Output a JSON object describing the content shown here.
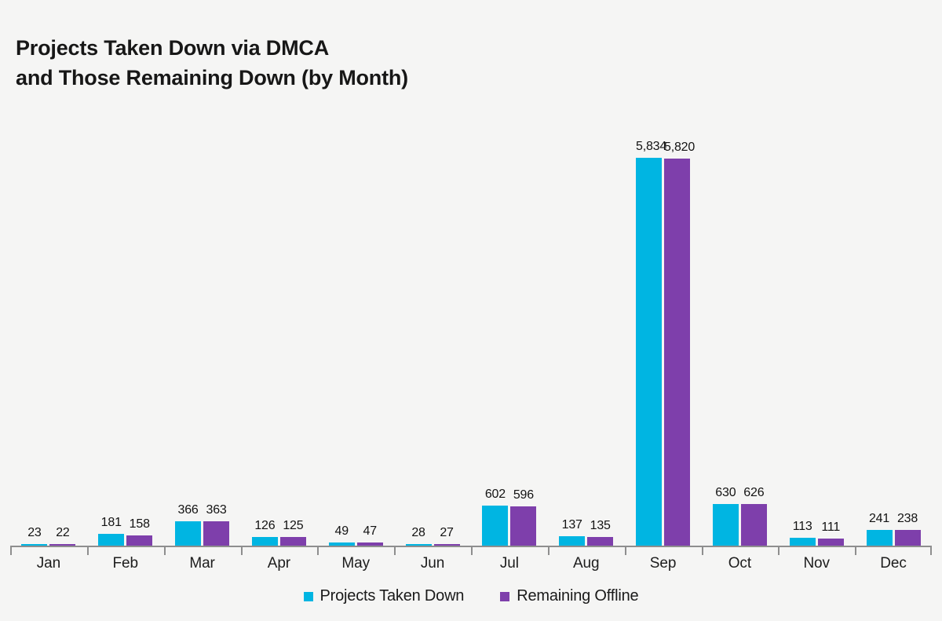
{
  "chart_data": {
    "type": "bar",
    "title": "Projects Taken Down via DMCA\nand Those Remaining Down (by Month)",
    "xlabel": "",
    "ylabel": "",
    "grid": false,
    "legend_position": "bottom-center",
    "ylim": [
      0,
      6100
    ],
    "categories": [
      "Jan",
      "Feb",
      "Mar",
      "Apr",
      "May",
      "Jun",
      "Jul",
      "Aug",
      "Sep",
      "Oct",
      "Nov",
      "Dec"
    ],
    "series": [
      {
        "name": "Projects Taken Down",
        "color": "#00b5e2",
        "values": [
          23,
          181,
          366,
          126,
          49,
          28,
          602,
          137,
          5834,
          630,
          113,
          241
        ],
        "labels": [
          "23",
          "181",
          "366",
          "126",
          "49",
          "28",
          "602",
          "137",
          "5,834",
          "630",
          "113",
          "241"
        ]
      },
      {
        "name": "Remaining Offline",
        "color": "#7e3fab",
        "values": [
          22,
          158,
          363,
          125,
          47,
          27,
          596,
          135,
          5820,
          626,
          111,
          238
        ],
        "labels": [
          "22",
          "158",
          "363",
          "125",
          "47",
          "27",
          "596",
          "135",
          "5,820",
          "626",
          "111",
          "238"
        ]
      }
    ]
  },
  "colors": {
    "background": "#f5f5f4",
    "axis": "#8e8e8e",
    "text": "#1a1a1a",
    "series1": "#00b5e2",
    "series2": "#7e3fab"
  }
}
